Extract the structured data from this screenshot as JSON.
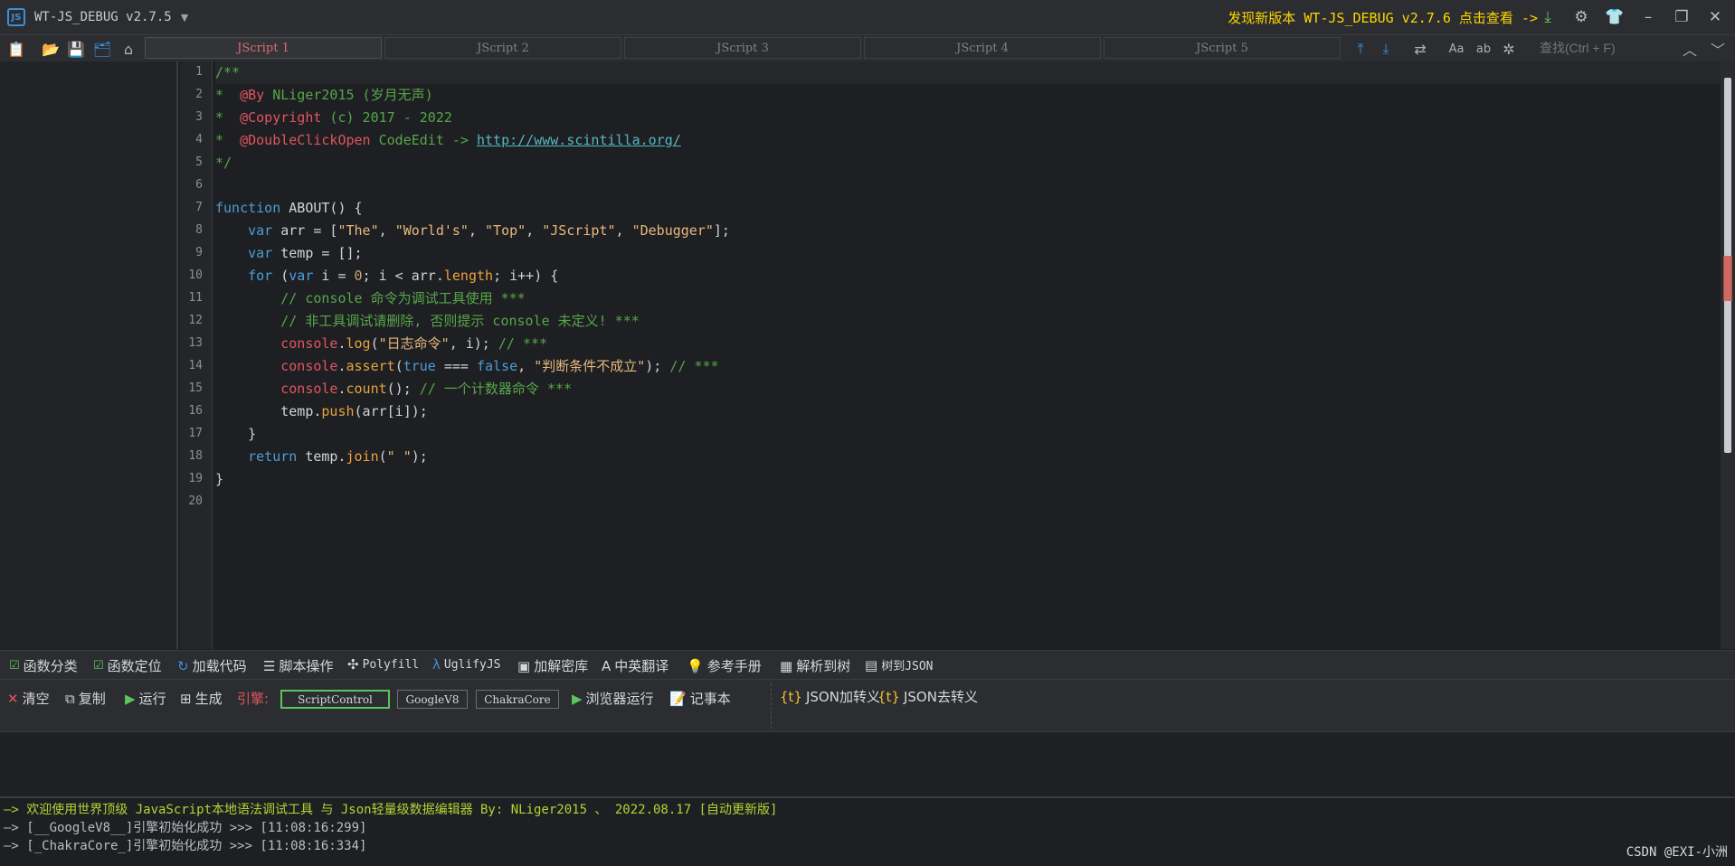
{
  "window": {
    "title": "WT-JS_DEBUG v2.7.5",
    "app_icon": "JS",
    "update_notice": "发现新版本 WT-JS_DEBUG v2.7.6 点击查看 ->"
  },
  "tabs": [
    "JScript 1",
    "JScript 2",
    "JScript 3",
    "JScript 4",
    "JScript 5"
  ],
  "active_tab": 0,
  "search": {
    "placeholder": "查找(Ctrl + F)"
  },
  "editor": {
    "line_numbers": [
      "1",
      "2",
      "3",
      "4",
      "5",
      "6",
      "7",
      "8",
      "9",
      "10",
      "11",
      "12",
      "13",
      "14",
      "15",
      "16",
      "17",
      "18",
      "19",
      "20"
    ]
  },
  "func_bar": {
    "items": [
      "函数分类",
      "函数定位",
      "加载代码",
      "脚本操作",
      "Polyfill",
      "UglifyJS",
      "加解密库",
      "中英翻译",
      "参考手册",
      "解析到树",
      "树到JSON"
    ]
  },
  "action_bar": {
    "clear": "清空",
    "copy": "复制",
    "run": "运行",
    "generate": "生成",
    "engine_label": "引擎:",
    "engines": [
      "ScriptControl",
      "GoogleV8",
      "ChakraCore"
    ],
    "selected_engine": "ScriptControl",
    "browser_run": "浏览器运行",
    "notepad": "记事本",
    "json_escape": "JSON加转义",
    "json_unescape": "JSON去转义"
  },
  "console": {
    "lines": [
      "—> 欢迎使用世界顶级 JavaScript本地语法调试工具 与 Json轻量级数据编辑器 By: NLiger2015 、 2022.08.17 [自动更新版]",
      "—> [__GoogleV8__]引擎初始化成功 >>> [11:08:16:299]",
      "—> [_ChakraCore_]引擎初始化成功 >>> [11:08:16:334]"
    ]
  },
  "watermark": "CSDN @EXI-小洲",
  "colors": {
    "accent_yellow": "#ffd700",
    "console_green": "#b5d334",
    "selected_engine": "#5cc45c",
    "active_tab": "#e06c75"
  },
  "icons": [
    "clipboard-icon",
    "open-folder-icon",
    "save-icon",
    "save-all-icon",
    "clear-icon",
    "download-icon",
    "settings-icon",
    "shirt-icon",
    "minimize-icon",
    "restore-icon",
    "close-icon"
  ]
}
